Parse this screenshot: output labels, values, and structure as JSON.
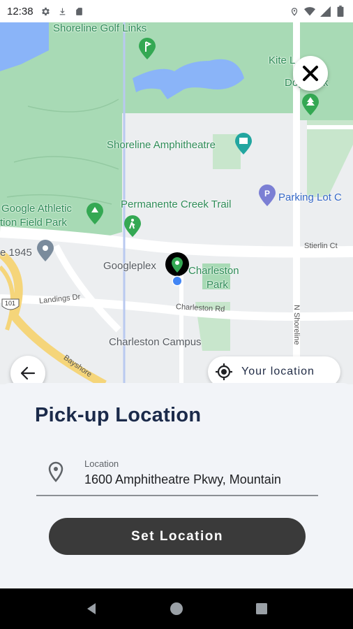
{
  "status_bar": {
    "time": "12:38",
    "left_icons": [
      "gear-icon",
      "download-icon",
      "sd-card-icon"
    ],
    "right_icons": [
      "location-icon",
      "wifi-icon",
      "signal-icon",
      "battery-icon"
    ]
  },
  "map": {
    "labels": {
      "shoreline_golf": "Shoreline Golf Links",
      "kite": "Kite L",
      "dog_park": "Dog Park",
      "amphitheatre": "Shoreline Amphitheatre",
      "parking": "Parking Lot C",
      "google_athletic_1": "Google Athletic",
      "google_athletic_2": "tion Field Park",
      "permanente": "Permanente Creek Trail",
      "num_1945": "e 1945",
      "googleplex": "Googleplex",
      "charleston_park_1": "Charleston",
      "charleston_park_2": "Park",
      "charleston_campus": "Charleston Campus"
    },
    "roads": {
      "stierlin": "Stierlin Ct",
      "landings": "Landings Dr",
      "charleston_rd": "Charleston Rd",
      "n_shoreline": "N Shoreline",
      "bayshore": "Bayshore",
      "hwy_101": "101"
    }
  },
  "controls": {
    "your_location": "Your location"
  },
  "sheet": {
    "title": "Pick-up Location",
    "field_caption": "Location",
    "field_value": "1600 Amphitheatre Pkwy, Mountain",
    "set_button": "Set Location"
  },
  "colors": {
    "title": "#1b2a4a",
    "button_bg": "#3a3a3a",
    "park_green": "#a8dab5",
    "water_blue": "#8ab4f8",
    "pin_green": "#34a853",
    "pin_purple": "#7b7fd4",
    "location_dot": "#4285f4"
  }
}
